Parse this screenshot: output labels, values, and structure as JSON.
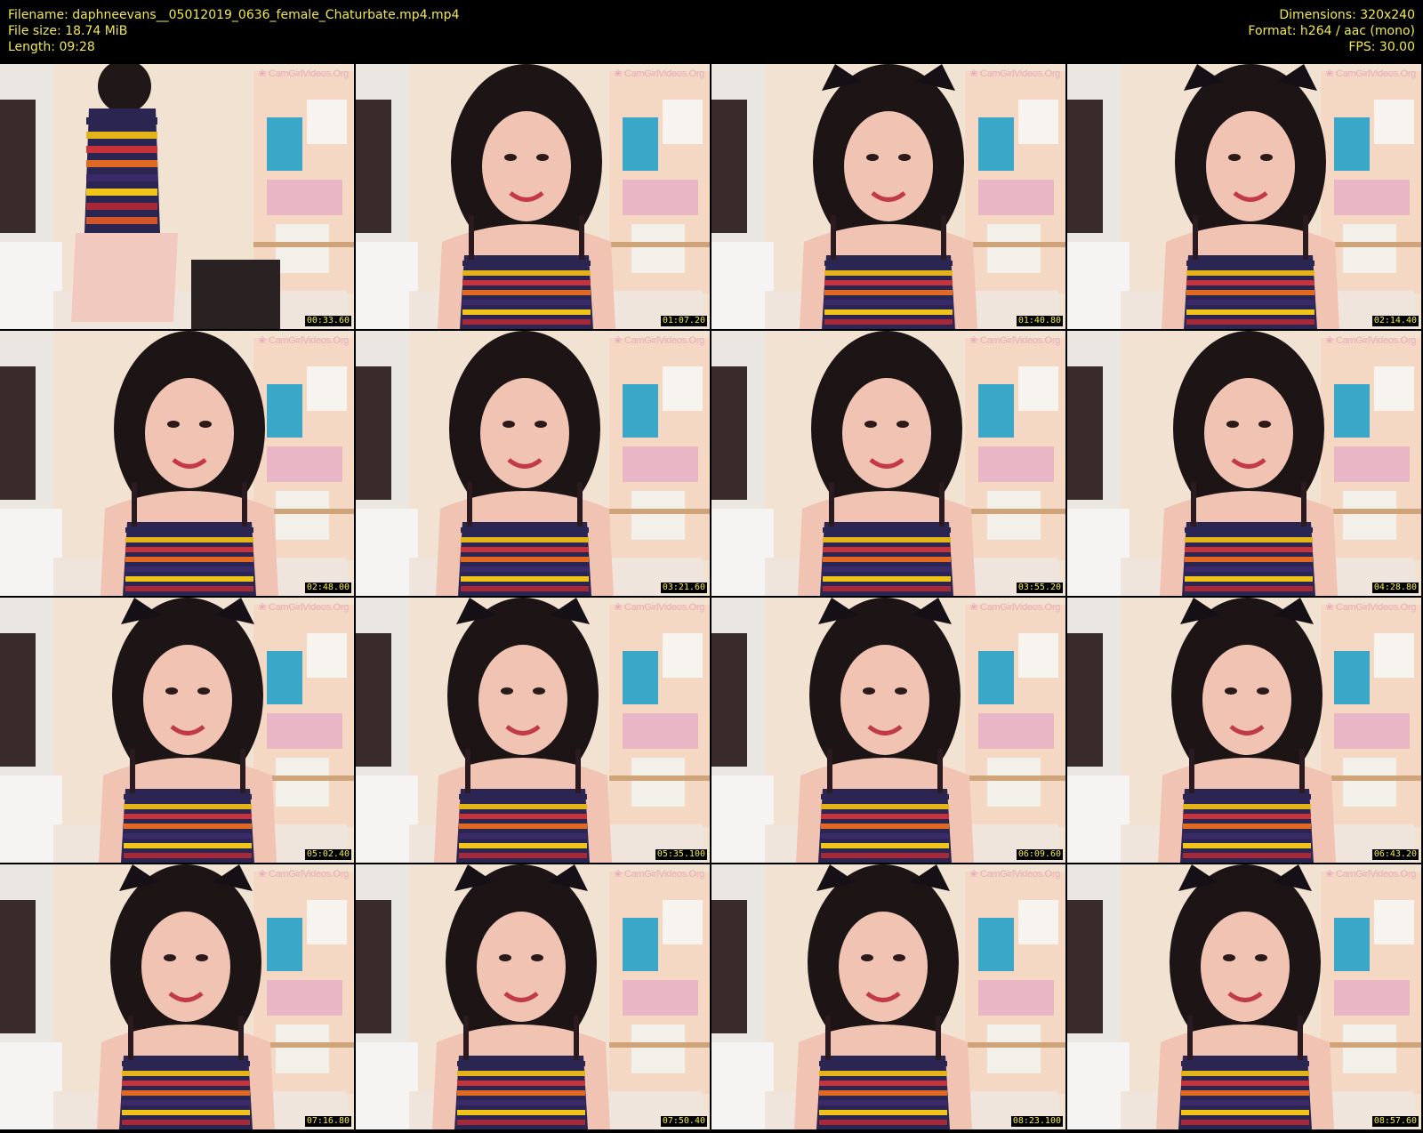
{
  "header": {
    "filename": "Filename: daphneevans__05012019_0636_female_Chaturbate.mp4.mp4",
    "filesize": "File size: 18.74 MiB",
    "length": "Length: 09:28",
    "dimensions": "Dimensions: 320x240",
    "format": "Format: h264 / aac (mono)",
    "fps": "FPS: 30.00"
  },
  "colors": {
    "meta_text": "#f2e94e",
    "background": "#000000"
  },
  "thumbnails": [
    {
      "time": "00:33.60",
      "watermark": "CamGirlVideos.Org"
    },
    {
      "time": "01:07.20",
      "watermark": "CamGirlVideos.Org"
    },
    {
      "time": "01:40.80",
      "watermark": "CamGirlVideos.Org"
    },
    {
      "time": "02:14.40",
      "watermark": "CamGirlVideos.Org"
    },
    {
      "time": "02:48.00",
      "watermark": "CamGirlVideos.Org"
    },
    {
      "time": "03:21.60",
      "watermark": "CamGirlVideos.Org"
    },
    {
      "time": "03:55.20",
      "watermark": "CamGirlVideos.Org"
    },
    {
      "time": "04:28.80",
      "watermark": "CamGirlVideos.Org"
    },
    {
      "time": "05:02.40",
      "watermark": "CamGirlVideos.Org"
    },
    {
      "time": "05:35.100",
      "watermark": "CamGirlVideos.Org"
    },
    {
      "time": "06:09.60",
      "watermark": "CamGirlVideos.Org"
    },
    {
      "time": "06:43.20",
      "watermark": "CamGirlVideos.Org"
    },
    {
      "time": "07:16.80",
      "watermark": "CamGirlVideos.Org"
    },
    {
      "time": "07:50.40",
      "watermark": "CamGirlVideos.Org"
    },
    {
      "time": "08:23.100",
      "watermark": "CamGirlVideos.Org"
    },
    {
      "time": "08:57.60",
      "watermark": "CamGirlVideos.Org"
    }
  ]
}
